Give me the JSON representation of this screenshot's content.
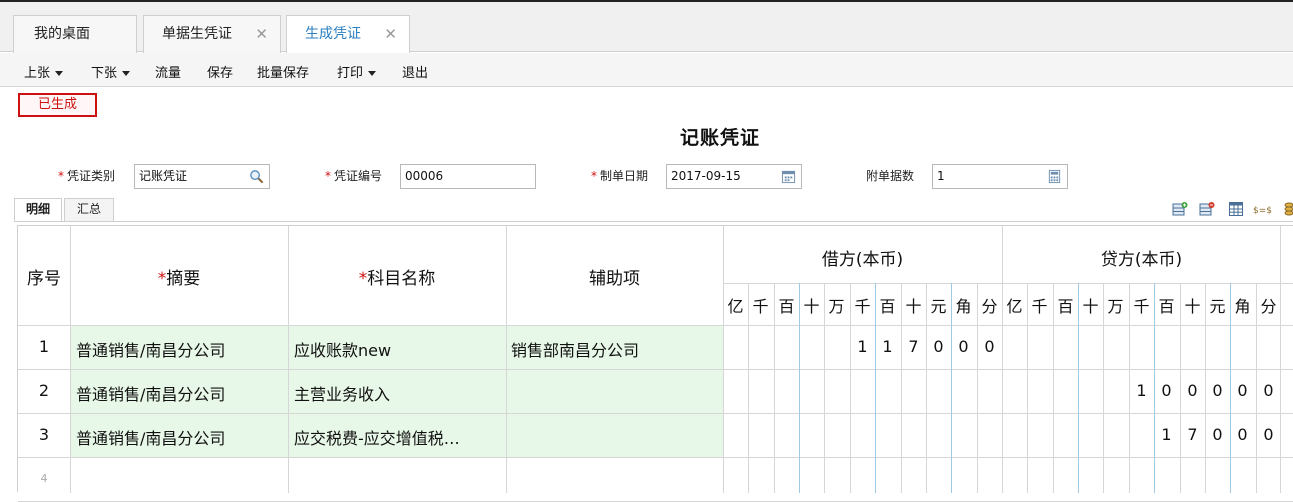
{
  "tabs": [
    {
      "label": "我的桌面",
      "closable": false
    },
    {
      "label": "单据生凭证",
      "closable": true
    },
    {
      "label": "生成凭证",
      "closable": true
    }
  ],
  "toolbar": {
    "prev": "上张",
    "next": "下张",
    "flow": "流量",
    "save": "保存",
    "batch_save": "批量保存",
    "print": "打印",
    "exit": "退出"
  },
  "status_badge": "已生成",
  "voucher_title": "记账凭证",
  "form": {
    "category_label": "凭证类别",
    "category_value": "记账凭证",
    "number_label": "凭证编号",
    "number_value": "00006",
    "date_label": "制单日期",
    "date_value": "2017-09-15",
    "attachments_label": "附单据数",
    "attachments_value": "1"
  },
  "subtabs": [
    "明细",
    "汇总"
  ],
  "table": {
    "headers": {
      "seq": "序号",
      "summary": "摘要",
      "account": "科目名称",
      "aux": "辅助项",
      "debit": "借方(本币)",
      "credit": "贷方(本币)"
    },
    "digit_units": [
      "亿",
      "千",
      "百",
      "十",
      "万",
      "千",
      "百",
      "十",
      "元",
      "角",
      "分"
    ],
    "rows": [
      {
        "seq": "1",
        "summary": "普通销售/南昌分公司",
        "account": "应收账款new",
        "aux": "销售部南昌分公司",
        "debit": "117000",
        "credit": ""
      },
      {
        "seq": "2",
        "summary": "普通销售/南昌分公司",
        "account": "主营业务收入",
        "aux": "",
        "debit": "",
        "credit": "100000"
      },
      {
        "seq": "3",
        "summary": "普通销售/南昌分公司",
        "account": "应交税费-应交增值税…",
        "aux": "",
        "debit": "",
        "credit": "17000"
      },
      {
        "seq": "4",
        "summary": "",
        "account": "",
        "aux": "",
        "debit": "",
        "credit": ""
      }
    ]
  },
  "colors": {
    "accent": "#2a7fc0",
    "required": "#d01111",
    "status_border": "#cc1111",
    "summary_bg": "#e8f8e8"
  }
}
